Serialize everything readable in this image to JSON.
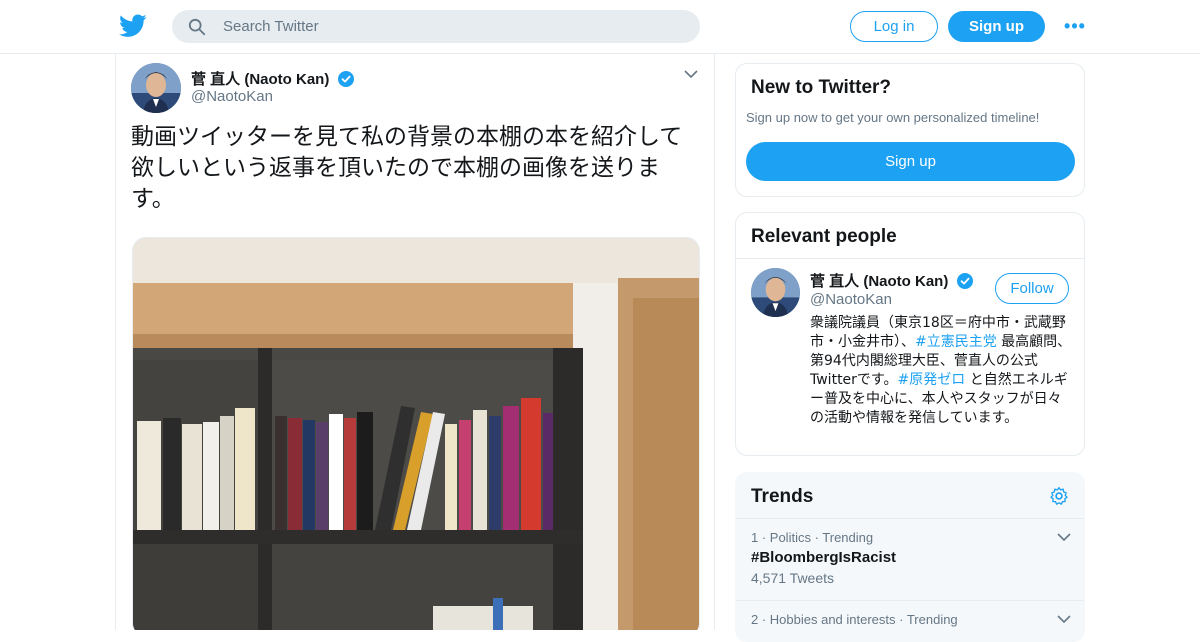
{
  "header": {
    "search_placeholder": "Search Twitter",
    "login_label": "Log in",
    "signup_label": "Sign up",
    "more_label": "•••"
  },
  "tweet": {
    "author_name": "菅 直人 (Naoto Kan)",
    "author_handle": "@NaotoKan",
    "text": "動画ツイッターを見て私の背景の本棚の本を紹介して欲しいという返事を頂いたので本棚の画像を送ります。"
  },
  "new_to_twitter": {
    "title": "New to Twitter?",
    "subtitle": "Sign up now to get your own personalized timeline!",
    "signup_label": "Sign up"
  },
  "relevant_people": {
    "title": "Relevant people",
    "person": {
      "name": "菅 直人 (Naoto Kan)",
      "handle": "@NaotoKan",
      "follow_label": "Follow",
      "bio_part1": "衆議院議員（東京18区＝府中市・武蔵野市・小金井市）、",
      "bio_hash1": "#立憲民主党",
      "bio_part2": " 最高顧問、第94代内閣総理大臣、菅直人の公式Twitterです。",
      "bio_hash2": "#原発ゼロ",
      "bio_part3": " と自然エネルギー普及を中心に、本人やスタッフが日々の活動や情報を発信しています。"
    }
  },
  "trends": {
    "title": "Trends",
    "items": [
      {
        "meta": "1 · Politics · Trending",
        "name": "#BloombergIsRacist",
        "count": "4,571 Tweets"
      },
      {
        "meta": "2 · Hobbies and interests · Trending",
        "name": "",
        "count": ""
      }
    ]
  },
  "colors": {
    "brand": "#1da1f2",
    "text_primary": "#14171a",
    "text_secondary": "#657786",
    "border": "#e6ecf0"
  },
  "icons": [
    "twitter-bird-icon",
    "search-icon",
    "verified-badge-icon",
    "chevron-down-icon",
    "gear-icon"
  ]
}
